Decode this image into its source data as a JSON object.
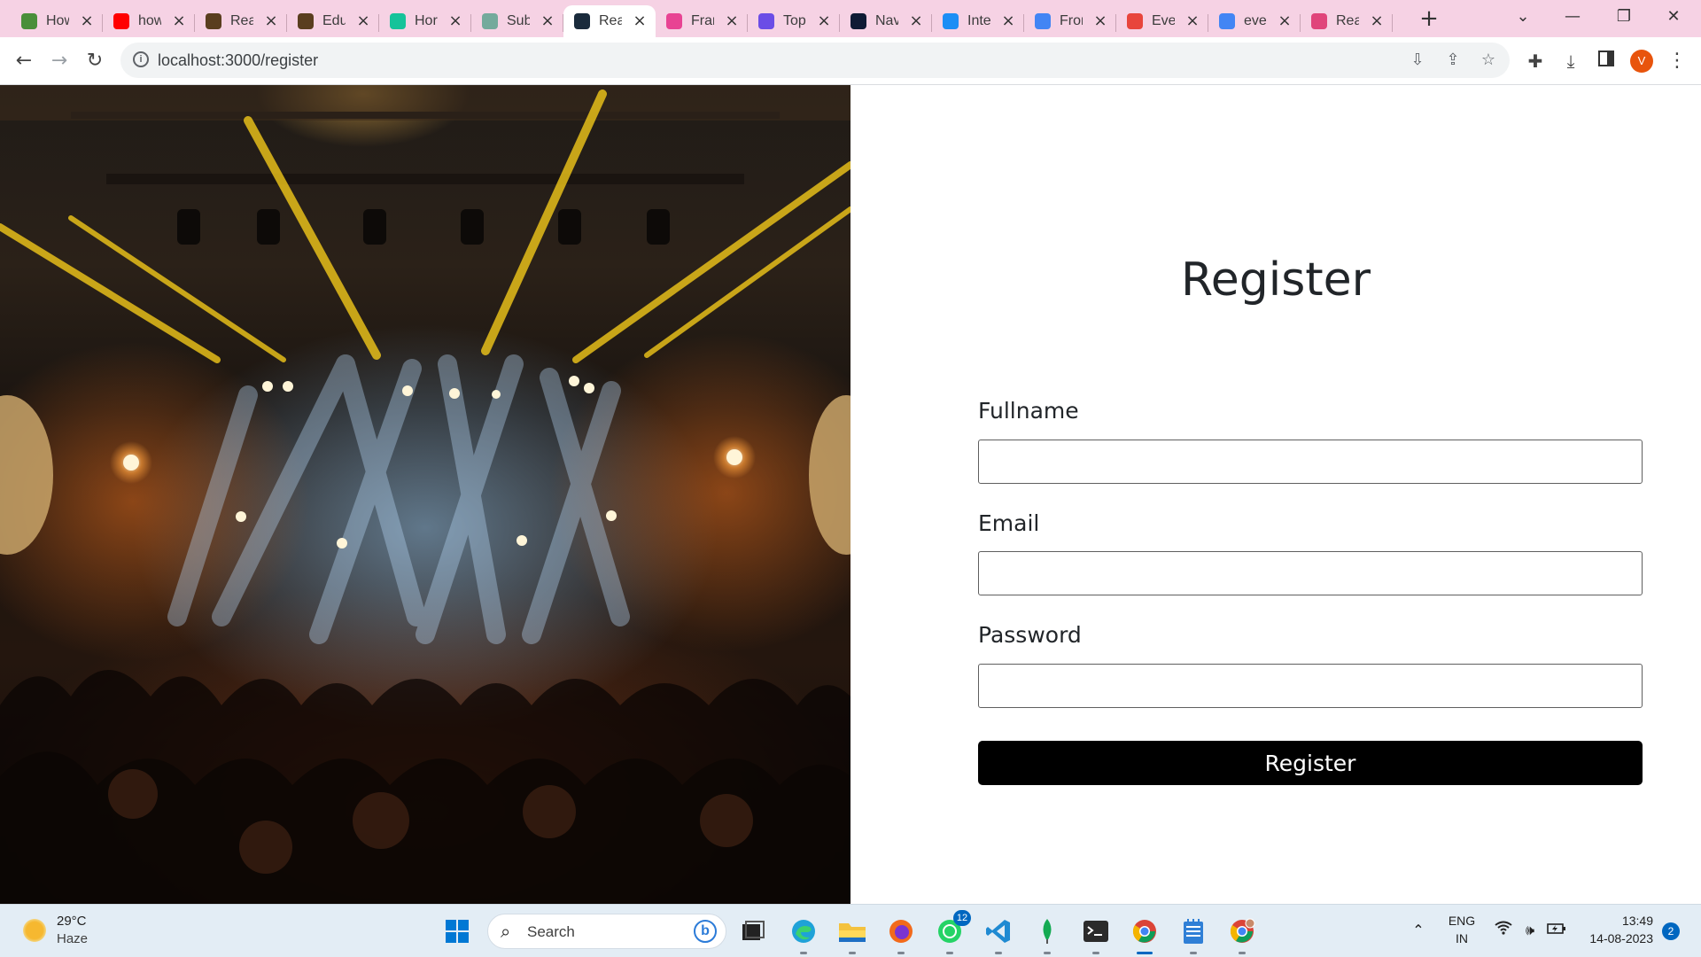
{
  "browser": {
    "tabs": [
      {
        "title": "How",
        "icon": "link-icon",
        "color": "#4a8f3a"
      },
      {
        "title": "how",
        "icon": "youtube-icon",
        "color": "#ff0000"
      },
      {
        "title": "Rea",
        "icon": "book-icon",
        "color": "#5a3e1f"
      },
      {
        "title": "Edu",
        "icon": "book-icon",
        "color": "#5a3e1f"
      },
      {
        "title": "Hor",
        "icon": "grammarly-icon",
        "color": "#15c39a"
      },
      {
        "title": "Sub",
        "icon": "chatgpt-icon",
        "color": "#74aa9c"
      },
      {
        "title": "Rea",
        "icon": "react-icon",
        "color": "#1a2b3c",
        "active": true
      },
      {
        "title": "Frar",
        "icon": "framer-icon",
        "color": "#e84393"
      },
      {
        "title": "Top",
        "icon": "codefile-icon",
        "color": "#6b4de6"
      },
      {
        "title": "Nav",
        "icon": "codeworld-icon",
        "color": "#0f1b35"
      },
      {
        "title": "Inte",
        "icon": "interview-icon",
        "color": "#1c8ef5"
      },
      {
        "title": "Fror",
        "icon": "docs-icon",
        "color": "#4285f4"
      },
      {
        "title": "Ever",
        "icon": "edge-icon",
        "color": "#e8453c"
      },
      {
        "title": "eve",
        "icon": "google-icon",
        "color": "#4285f4"
      },
      {
        "title": "Rea",
        "icon": "react-icon",
        "color": "#e0457b"
      }
    ],
    "new_tab": "+",
    "controls": {
      "list": "⌄",
      "minimize": "—",
      "restore": "❐",
      "close": "✕"
    },
    "nav": {
      "back": "←",
      "forward": "→",
      "reload": "↻"
    },
    "url": "localhost:3000/register",
    "profile_initial": "V"
  },
  "page": {
    "title": "Register",
    "fields": [
      {
        "label": "Fullname",
        "value": "",
        "placeholder": ""
      },
      {
        "label": "Email",
        "value": "",
        "placeholder": ""
      },
      {
        "label": "Password",
        "value": "",
        "placeholder": ""
      }
    ],
    "submit_label": "Register"
  },
  "taskbar": {
    "weather": {
      "temp": "29°C",
      "desc": "Haze"
    },
    "search_placeholder": "Search",
    "whatsapp_badge": "12",
    "lang_top": "ENG",
    "lang_bottom": "IN",
    "time": "13:49",
    "date": "14-08-2023",
    "notifications": "2"
  }
}
